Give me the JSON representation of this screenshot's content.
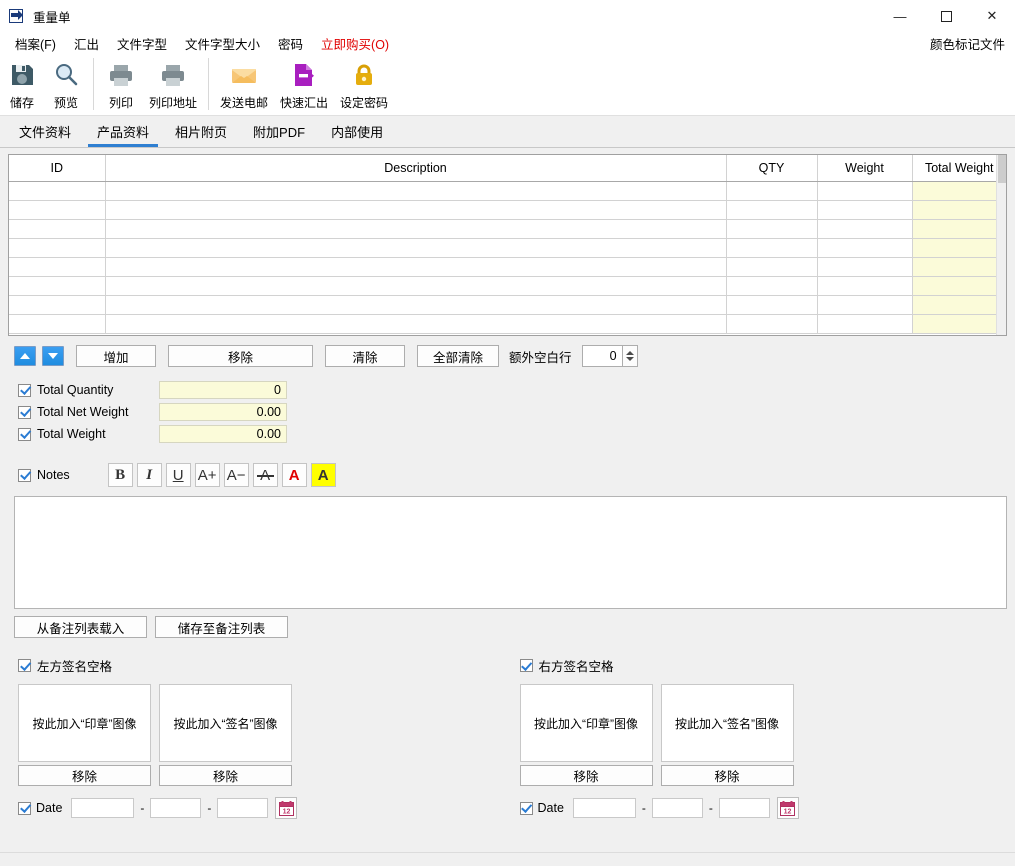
{
  "window": {
    "title": "重量单",
    "app_icon": "export-document-icon",
    "controls": {
      "minimize": "—",
      "maximize": "☐",
      "close": "✕"
    }
  },
  "menubar": {
    "items": [
      {
        "label": "档案(F)",
        "accent": false
      },
      {
        "label": "汇出",
        "accent": false
      },
      {
        "label": "文件字型",
        "accent": false
      },
      {
        "label": "文件字型大小",
        "accent": false
      },
      {
        "label": "密码",
        "accent": false
      },
      {
        "label": "立即购买(O)",
        "accent": true
      }
    ],
    "right_label": "颜色标记文件",
    "accent_color": "#e00000"
  },
  "toolbar": {
    "buttons": [
      {
        "label": "储存",
        "icon": "save-floppy-icon"
      },
      {
        "label": "预览",
        "icon": "magnifier-preview-icon"
      },
      {
        "label": "列印",
        "icon": "printer-icon"
      },
      {
        "label": "列印地址",
        "icon": "printer-address-icon"
      },
      {
        "label": "发送电邮",
        "icon": "envelope-mail-icon"
      },
      {
        "label": "快速汇出",
        "icon": "quick-export-icon"
      },
      {
        "label": "设定密码",
        "icon": "padlock-icon"
      }
    ]
  },
  "tabs": {
    "items": [
      {
        "label": "文件资料",
        "active": false
      },
      {
        "label": "产品资料",
        "active": true
      },
      {
        "label": "相片附页",
        "active": false
      },
      {
        "label": "附加PDF",
        "active": false
      },
      {
        "label": "内部使用",
        "active": false
      }
    ],
    "active_underline_color": "#2f7fd1"
  },
  "product_table": {
    "columns": [
      "ID",
      "Description",
      "QTY",
      "Weight",
      "Total Weight"
    ],
    "row_count": 8,
    "rows": [
      [
        "",
        "",
        "",
        "",
        ""
      ],
      [
        "",
        "",
        "",
        "",
        ""
      ],
      [
        "",
        "",
        "",
        "",
        ""
      ],
      [
        "",
        "",
        "",
        "",
        ""
      ],
      [
        "",
        "",
        "",
        "",
        ""
      ],
      [
        "",
        "",
        "",
        "",
        ""
      ],
      [
        "",
        "",
        "",
        "",
        ""
      ],
      [
        "",
        "",
        "",
        "",
        ""
      ]
    ],
    "highlight_column": "Total Weight",
    "highlight_color": "#fbfbd9"
  },
  "row_actions": {
    "move_up": "▲",
    "move_down": "▼",
    "add": "增加",
    "remove": "移除",
    "clear": "清除",
    "clear_all": "全部清除",
    "extra_blank_rows_label": "额外空白行",
    "extra_blank_rows_value": "0"
  },
  "totals": [
    {
      "label": "Total Quantity",
      "value": "0",
      "checked": true
    },
    {
      "label": "Total Net Weight",
      "value": "0.00",
      "checked": true
    },
    {
      "label": "Total Weight",
      "value": "0.00",
      "checked": true
    }
  ],
  "notes": {
    "label": "Notes",
    "checked": true,
    "text": "",
    "format_buttons": [
      {
        "name": "bold-button",
        "glyph": "B"
      },
      {
        "name": "italic-button",
        "glyph": "I"
      },
      {
        "name": "underline-button",
        "glyph": "U"
      },
      {
        "name": "font-increase-button",
        "glyph": "A+"
      },
      {
        "name": "font-decrease-button",
        "glyph": "A−"
      },
      {
        "name": "strikethrough-button",
        "glyph": "A"
      },
      {
        "name": "font-color-button",
        "glyph": "A"
      },
      {
        "name": "highlight-color-button",
        "glyph": "A"
      }
    ],
    "load_from_list": "从备注列表载入",
    "save_to_list": "储存至备注列表"
  },
  "signatures": {
    "left": {
      "header": "左方签名空格",
      "checked": true,
      "stamp_box": "按此加入“印章”图像",
      "sign_box": "按此加入“签名”图像",
      "stamp_remove": "移除",
      "sign_remove": "移除",
      "date_label": "Date",
      "date_checked": true,
      "date_year": "",
      "date_month": "",
      "date_day": "",
      "separator": "-",
      "calendar_icon": "calendar-icon"
    },
    "right": {
      "header": "右方签名空格",
      "checked": true,
      "stamp_box": "按此加入“印章”图像",
      "sign_box": "按此加入“签名”图像",
      "stamp_remove": "移除",
      "sign_remove": "移除",
      "date_label": "Date",
      "date_checked": true,
      "date_year": "",
      "date_month": "",
      "date_day": "",
      "separator": "-",
      "calendar_icon": "calendar-icon"
    }
  }
}
